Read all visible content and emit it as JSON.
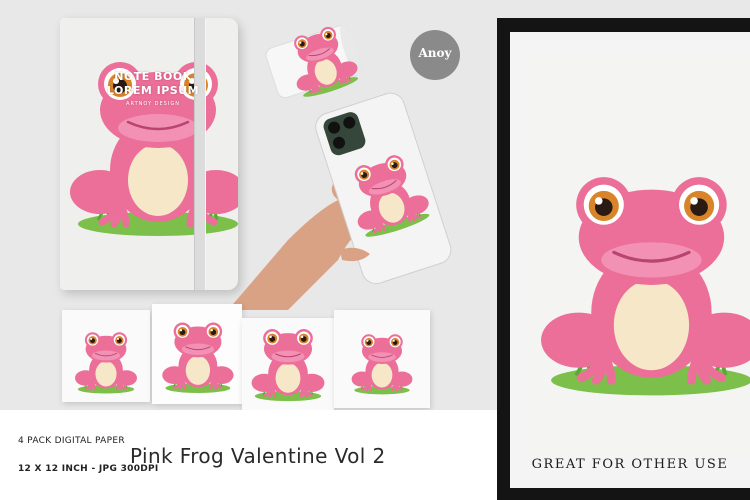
{
  "notebook": {
    "line1": "NOTE BOOK",
    "line2": "LOREM IPSUM",
    "line3": "ARTNOY DESIGN"
  },
  "logo": {
    "text": "Anoy"
  },
  "frame": {
    "caption": "GREAT FOR OTHER USE"
  },
  "banner": {
    "pack_label": "4 PACK DIGITAL PAPER",
    "title": "Pink Frog Valentine Vol 2",
    "size_label": "12 X 12 INCH - JPG 300DPI"
  },
  "colors": {
    "frog_pink": "#ec6f9a",
    "frog_light": "#f7a9c4",
    "belly": "#f6e7c8",
    "grass": "#7cbf4a",
    "eye": "#d8842a",
    "frame": "#141414"
  }
}
